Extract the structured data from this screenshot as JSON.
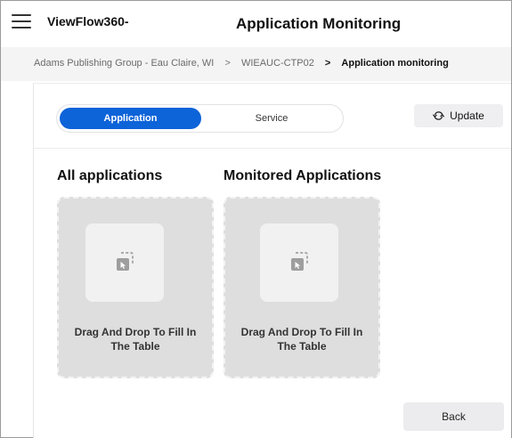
{
  "header": {
    "menu_icon": "hamburger-menu-icon",
    "brand": "ViewFlow360-",
    "title": "Application Monitoring"
  },
  "breadcrumb": {
    "items": [
      "Adams Publishing Group - Eau Claire, WI",
      "WIEAUC-CTP02",
      "Application monitoring"
    ],
    "separator": ">"
  },
  "toggle": {
    "options": [
      "Application",
      "Service"
    ],
    "selected": "Application"
  },
  "update": {
    "label": "Update",
    "icon": "refresh-icon"
  },
  "columns": [
    {
      "title": "All applications",
      "dropzone_text": "Drag And Drop To Fill In The Table",
      "icon": "drag-drop-icon"
    },
    {
      "title": "Monitored Applications",
      "dropzone_text": "Drag And Drop To Fill In The Table",
      "icon": "drag-drop-icon"
    }
  ],
  "footer": {
    "back_label": "Back"
  },
  "colors": {
    "accent": "#0d63d8",
    "dropzone_bg": "#dedede",
    "breadcrumb_bg": "#f4f4f5"
  }
}
